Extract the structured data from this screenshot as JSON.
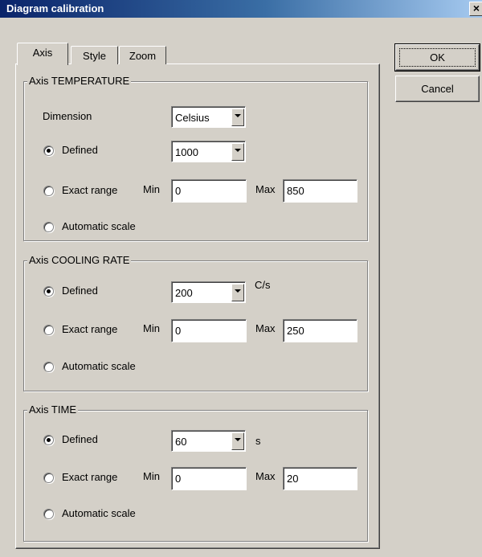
{
  "window": {
    "title": "Diagram calibration",
    "close_label": "×"
  },
  "buttons": {
    "ok": "OK",
    "cancel": "Cancel"
  },
  "tabs": [
    {
      "label": "Axis"
    },
    {
      "label": "Style"
    },
    {
      "label": "Zoom"
    }
  ],
  "temperature": {
    "legend": "Axis TEMPERATURE",
    "dimension_label": "Dimension",
    "dimension_value": "Celsius",
    "defined_label": "Defined",
    "defined_value": "1000",
    "exact_label": "Exact range",
    "min_label": "Min",
    "min_value": "0",
    "max_label": "Max",
    "max_value": "850",
    "auto_label": "Automatic scale",
    "selected": "defined"
  },
  "cooling": {
    "legend": "Axis COOLING RATE",
    "defined_label": "Defined",
    "defined_value": "200",
    "unit": "C/s",
    "exact_label": "Exact range",
    "min_label": "Min",
    "min_value": "0",
    "max_label": "Max",
    "max_value": "250",
    "auto_label": "Automatic scale",
    "selected": "defined"
  },
  "time": {
    "legend": "Axis TIME",
    "defined_label": "Defined",
    "defined_value": "60",
    "unit": "s",
    "exact_label": "Exact range",
    "min_label": "Min",
    "min_value": "0",
    "max_label": "Max",
    "max_value": "20",
    "auto_label": "Automatic scale",
    "selected": "defined"
  }
}
